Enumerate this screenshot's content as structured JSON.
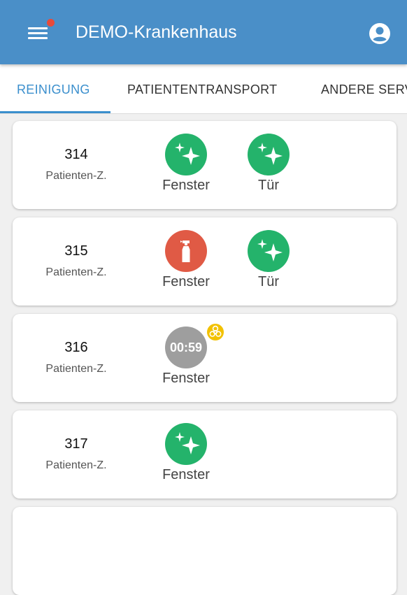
{
  "appbar": {
    "title": "DEMO-Krankenhaus",
    "accent_color": "#4a8fc8",
    "icons": {
      "menu": "menu-icon",
      "notification": "notification-dot",
      "account": "account-circle-icon"
    }
  },
  "tabs": [
    {
      "label": "REINIGUNG",
      "active": true
    },
    {
      "label": "PATIENTENTRANSPORT",
      "active": false
    },
    {
      "label": "ANDERE SERVICES",
      "active": false
    }
  ],
  "status_colors": {
    "done": "#24b36b",
    "pending": "#e05a45",
    "in_progress": "#9e9e9e",
    "hazard": "#f2c100"
  },
  "rooms": [
    {
      "number": "314",
      "type": "Patienten-Z.",
      "tasks": [
        {
          "label": "Fenster",
          "status": "done",
          "icon": "sparkle-icon"
        },
        {
          "label": "Tür",
          "status": "done",
          "icon": "sparkle-icon"
        }
      ]
    },
    {
      "number": "315",
      "type": "Patienten-Z.",
      "tasks": [
        {
          "label": "Fenster",
          "status": "pending",
          "icon": "spray-bottle-icon"
        },
        {
          "label": "Tür",
          "status": "done",
          "icon": "sparkle-icon"
        }
      ]
    },
    {
      "number": "316",
      "type": "Patienten-Z.",
      "tasks": [
        {
          "label": "Fenster",
          "status": "in_progress",
          "timer": "00:59",
          "icon": "biohazard-icon"
        }
      ]
    },
    {
      "number": "317",
      "type": "Patienten-Z.",
      "tasks": [
        {
          "label": "Fenster",
          "status": "done",
          "icon": "sparkle-icon"
        }
      ]
    }
  ]
}
